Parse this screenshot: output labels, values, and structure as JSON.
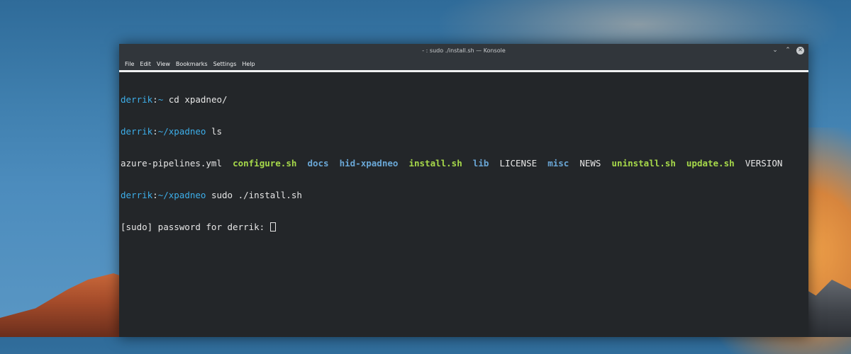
{
  "window": {
    "title": "- : sudo ./install.sh — Konsole",
    "controls": {
      "minimize": "⌄",
      "maximize": "⌃",
      "close": "✕"
    }
  },
  "menu": {
    "items": [
      "File",
      "Edit",
      "View",
      "Bookmarks",
      "Settings",
      "Help"
    ]
  },
  "terminal": {
    "line1": {
      "user": "derrik",
      "sep": ":",
      "path": "~",
      "command": " cd xpadneo/"
    },
    "line2": {
      "user": "derrik",
      "sep": ":",
      "path": "~/xpadneo",
      "command": " ls"
    },
    "listing": [
      {
        "name": "azure-pipelines.yml",
        "kind": "file"
      },
      {
        "name": "configure.sh",
        "kind": "exec"
      },
      {
        "name": "docs",
        "kind": "dir"
      },
      {
        "name": "hid-xpadneo",
        "kind": "dir"
      },
      {
        "name": "install.sh",
        "kind": "exec"
      },
      {
        "name": "lib",
        "kind": "dir"
      },
      {
        "name": "LICENSE",
        "kind": "file"
      },
      {
        "name": "misc",
        "kind": "dir"
      },
      {
        "name": "NEWS",
        "kind": "file"
      },
      {
        "name": "uninstall.sh",
        "kind": "exec"
      },
      {
        "name": "update.sh",
        "kind": "exec"
      },
      {
        "name": "VERSION",
        "kind": "file"
      }
    ],
    "line4": {
      "user": "derrik",
      "sep": ":",
      "path": "~/xpadneo",
      "command": " sudo ./install.sh"
    },
    "line5": {
      "text": "[sudo] password for derrik: "
    }
  },
  "colors": {
    "prompt": "#3daee9",
    "exec": "#a6d84a",
    "dir": "#6aa7d6",
    "text": "#e6e6e6",
    "background": "#232629"
  }
}
